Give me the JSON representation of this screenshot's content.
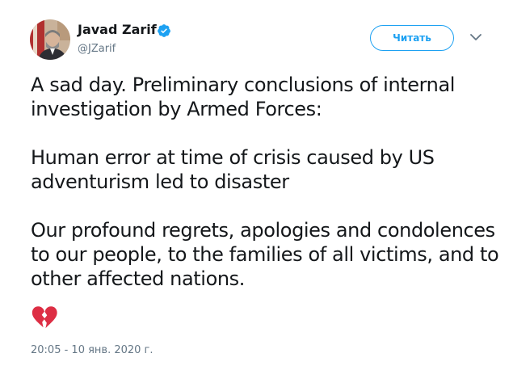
{
  "author": {
    "display_name": "Javad Zarif",
    "handle": "@JZarif",
    "verified": true,
    "avatar_icon": "profile-photo"
  },
  "actions": {
    "follow_label": "Читать",
    "menu_icon": "chevron-down-icon"
  },
  "tweet": {
    "paragraphs": [
      "A sad day. Preliminary conclusions of internal investigation by Armed Forces:",
      "Human error at time of crisis caused by US adventurism led to disaster",
      "Our profound regrets, apologies and condolences to our people, to the families of all victims, and to other affected nations."
    ],
    "emoji": "broken-heart",
    "timestamp": "20:05 - 10 янв. 2020 г."
  },
  "colors": {
    "accent": "#1da1f2",
    "text": "#14171a",
    "muted": "#657786",
    "emoji": "#dd2e44"
  }
}
